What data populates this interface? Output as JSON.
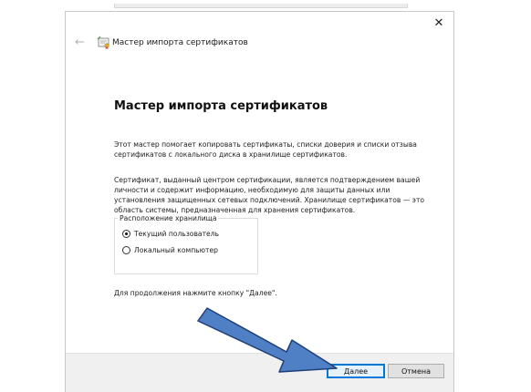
{
  "window": {
    "title": "Мастер импорта сертификатов",
    "close_glyph": "✕",
    "back_glyph": "←"
  },
  "content": {
    "heading": "Мастер импорта сертификатов",
    "paragraph1": "Этот мастер помогает копировать сертификаты, списки доверия и списки отзыва сертификатов с локального диска в хранилище сертификатов.",
    "paragraph2": "Сертификат, выданный центром сертификации, является подтверждением вашей личности и содержит информацию, необходимую для защиты данных или установления защищенных сетевых подключений. Хранилище сертификатов — это область системы, предназначенная для хранения сертификатов.",
    "store_group": {
      "label": "Расположение хранилища",
      "options": [
        {
          "label": "Текущий пользователь",
          "selected": true
        },
        {
          "label": "Локальный компьютер",
          "selected": false
        }
      ]
    },
    "continue_hint": "Для продолжения нажмите кнопку \"Далее\"."
  },
  "footer": {
    "next_label": "Далее",
    "cancel_label": "Отмена"
  },
  "colors": {
    "arrow_fill": "#4f7fc4",
    "arrow_stroke": "#1f3f7a",
    "accent": "#0078d7"
  },
  "icons": {
    "app": "certificate-icon",
    "back": "back-arrow-icon",
    "close": "close-icon",
    "overlay": "pointer-arrow-annotation"
  }
}
